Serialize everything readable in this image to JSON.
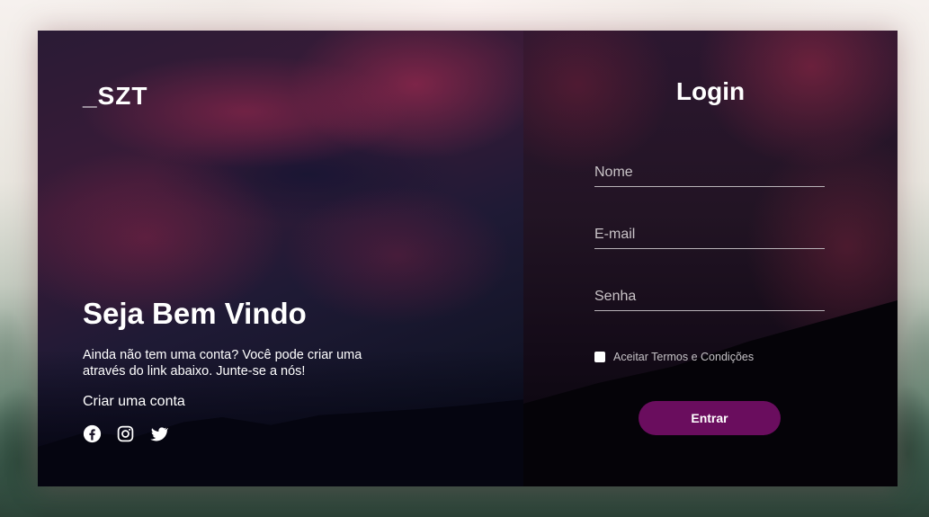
{
  "brand": {
    "logo_text": "_SZT"
  },
  "welcome": {
    "title": "Seja Bem Vindo",
    "description": "Ainda não tem uma conta? Você pode criar uma através do link abaixo. Junte-se a nós!",
    "create_link": "Criar uma conta"
  },
  "socials": [
    {
      "icon": "facebook-icon"
    },
    {
      "icon": "instagram-icon"
    },
    {
      "icon": "twitter-icon"
    }
  ],
  "login": {
    "title": "Login",
    "fields": {
      "name_placeholder": "Nome",
      "email_placeholder": "E-mail",
      "password_placeholder": "Senha"
    },
    "terms_label": "Aceitar Termos e Condições",
    "terms_checked": false,
    "submit_label": "Entrar"
  },
  "colors": {
    "button": "#6a0d5e",
    "text": "#ffffff"
  }
}
